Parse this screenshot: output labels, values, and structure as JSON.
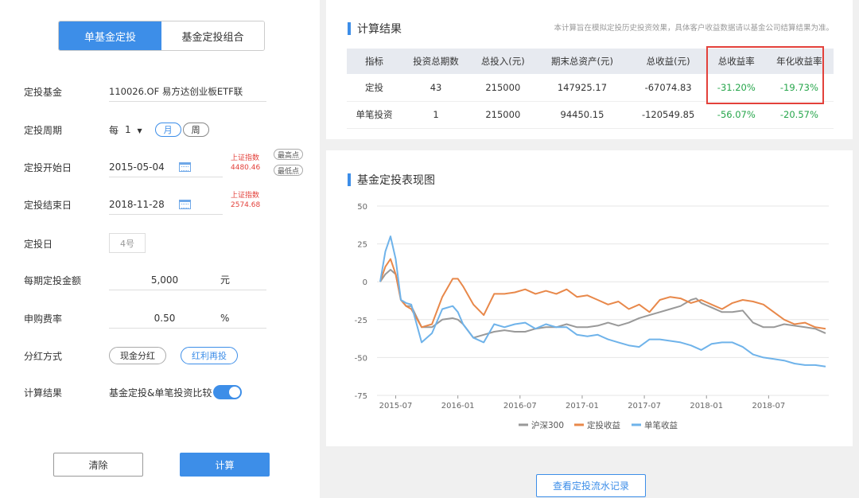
{
  "tabs": {
    "single": "单基金定投",
    "portfolio": "基金定投组合"
  },
  "form": {
    "fund_label": "定投基金",
    "fund_value": "110026.OF 易方达创业板ETF联",
    "period_label": "定投周期",
    "period_prefix": "每",
    "period_num": "1",
    "period_arrow": "▼",
    "period_month": "月",
    "period_week": "周",
    "start_label": "定投开始日",
    "start_date": "2015-05-04",
    "start_index_name": "上证指数",
    "start_index_value": "4480.46",
    "btn_high": "最高点",
    "btn_low": "最低点",
    "end_label": "定投结束日",
    "end_date": "2018-11-28",
    "end_index_name": "上证指数",
    "end_index_value": "2574.68",
    "day_label": "定投日",
    "day_value": "4号",
    "amount_label": "每期定投金额",
    "amount_value": "5,000",
    "amount_unit": "元",
    "fee_label": "申购费率",
    "fee_value": "0.50",
    "fee_unit": "%",
    "dividend_label": "分红方式",
    "dividend_cash": "现金分红",
    "dividend_reinvest": "红利再投",
    "result_label": "计算结果",
    "result_value": "基金定投&单笔投资比较",
    "clear": "清除",
    "calc": "计算"
  },
  "results": {
    "title": "计算结果",
    "note": "本计算旨在模拟定投历史投资效果，具体客户收益数据请以基金公司结算结果为准。",
    "headers": [
      "指标",
      "投资总期数",
      "总投入(元)",
      "期末总资产(元)",
      "总收益(元)",
      "总收益率",
      "年化收益率"
    ],
    "rows": [
      [
        "定投",
        "43",
        "215000",
        "147925.17",
        "-67074.83",
        "-31.20%",
        "-19.73%"
      ],
      [
        "单笔投资",
        "1",
        "215000",
        "94450.15",
        "-120549.85",
        "-56.07%",
        "-20.57%"
      ]
    ]
  },
  "chart_section": {
    "title": "基金定投表现图",
    "flow_button": "查看定投流水记录"
  },
  "chart_data": {
    "type": "line",
    "title": "",
    "xlabel": "",
    "ylabel": "",
    "x_ticks": [
      "2015-07",
      "2016-01",
      "2016-07",
      "2017-01",
      "2017-07",
      "2018-01",
      "2018-07"
    ],
    "y_ticks": [
      50,
      25,
      0,
      -25,
      -50,
      -75
    ],
    "ylim": [
      -75,
      50
    ],
    "x_range": [
      0,
      43
    ],
    "x_tick_positions": [
      1.5,
      7.5,
      13.5,
      19.5,
      25.5,
      31.5,
      37.5
    ],
    "legend_position": "bottom",
    "grid": true,
    "colors": {
      "hs300": "#999999",
      "dingtou": "#e8884a",
      "single": "#6fb3ea"
    },
    "series": [
      {
        "name": "沪深300",
        "key": "hs300",
        "x": [
          0,
          0.5,
          1,
          1.5,
          2,
          2.5,
          3,
          4,
          5,
          6,
          7,
          7.5,
          8,
          9,
          10,
          11,
          12,
          13,
          14,
          15,
          16,
          17,
          18,
          19,
          20,
          21,
          22,
          23,
          24,
          25,
          26,
          27,
          28,
          29,
          30,
          30.5,
          31,
          32,
          33,
          34,
          35,
          36,
          37,
          38,
          39,
          40,
          41,
          42,
          43
        ],
        "y": [
          0,
          5,
          8,
          5,
          -12,
          -16,
          -16,
          -30,
          -30,
          -25,
          -24,
          -25,
          -28,
          -37,
          -35,
          -33,
          -32,
          -33,
          -33,
          -31,
          -30,
          -30,
          -28,
          -30,
          -30,
          -29,
          -27,
          -29,
          -27,
          -24,
          -22,
          -20,
          -18,
          -16,
          -12,
          -11,
          -14,
          -17,
          -20,
          -20,
          -19,
          -27,
          -30,
          -30,
          -28,
          -29,
          -30,
          -31,
          -34
        ]
      },
      {
        "name": "定投收益",
        "key": "dingtou",
        "x": [
          0,
          0.5,
          1,
          1.5,
          2,
          2.5,
          3,
          4,
          5,
          6,
          7,
          7.5,
          8,
          9,
          10,
          11,
          12,
          13,
          14,
          15,
          16,
          17,
          18,
          19,
          20,
          21,
          22,
          23,
          24,
          25,
          26,
          27,
          28,
          29,
          30,
          31,
          32,
          33,
          34,
          35,
          36,
          37,
          38,
          39,
          40,
          41,
          42,
          43
        ],
        "y": [
          0,
          10,
          15,
          5,
          -12,
          -16,
          -18,
          -30,
          -28,
          -10,
          2,
          2,
          -3,
          -15,
          -22,
          -8,
          -8,
          -7,
          -5,
          -8,
          -6,
          -8,
          -5,
          -10,
          -9,
          -12,
          -15,
          -13,
          -18,
          -15,
          -20,
          -12,
          -10,
          -11,
          -14,
          -12,
          -15,
          -18,
          -14,
          -12,
          -13,
          -15,
          -20,
          -25,
          -28,
          -27,
          -30,
          -31
        ]
      },
      {
        "name": "单笔收益",
        "key": "single",
        "x": [
          0,
          0.5,
          1,
          1.5,
          2,
          2.5,
          3,
          4,
          5,
          6,
          7,
          7.5,
          8,
          9,
          10,
          11,
          12,
          13,
          14,
          15,
          16,
          17,
          18,
          19,
          20,
          21,
          22,
          23,
          24,
          25,
          26,
          27,
          28,
          29,
          30,
          31,
          32,
          33,
          34,
          35,
          36,
          37,
          38,
          39,
          40,
          41,
          42,
          43
        ],
        "y": [
          0,
          20,
          30,
          15,
          -12,
          -14,
          -15,
          -40,
          -34,
          -18,
          -16,
          -20,
          -28,
          -37,
          -40,
          -28,
          -30,
          -28,
          -27,
          -31,
          -28,
          -30,
          -30,
          -35,
          -36,
          -35,
          -38,
          -40,
          -42,
          -43,
          -38,
          -38,
          -39,
          -40,
          -42,
          -45,
          -41,
          -40,
          -40,
          -43,
          -48,
          -50,
          -51,
          -52,
          -54,
          -55,
          -55,
          -56
        ]
      }
    ]
  }
}
